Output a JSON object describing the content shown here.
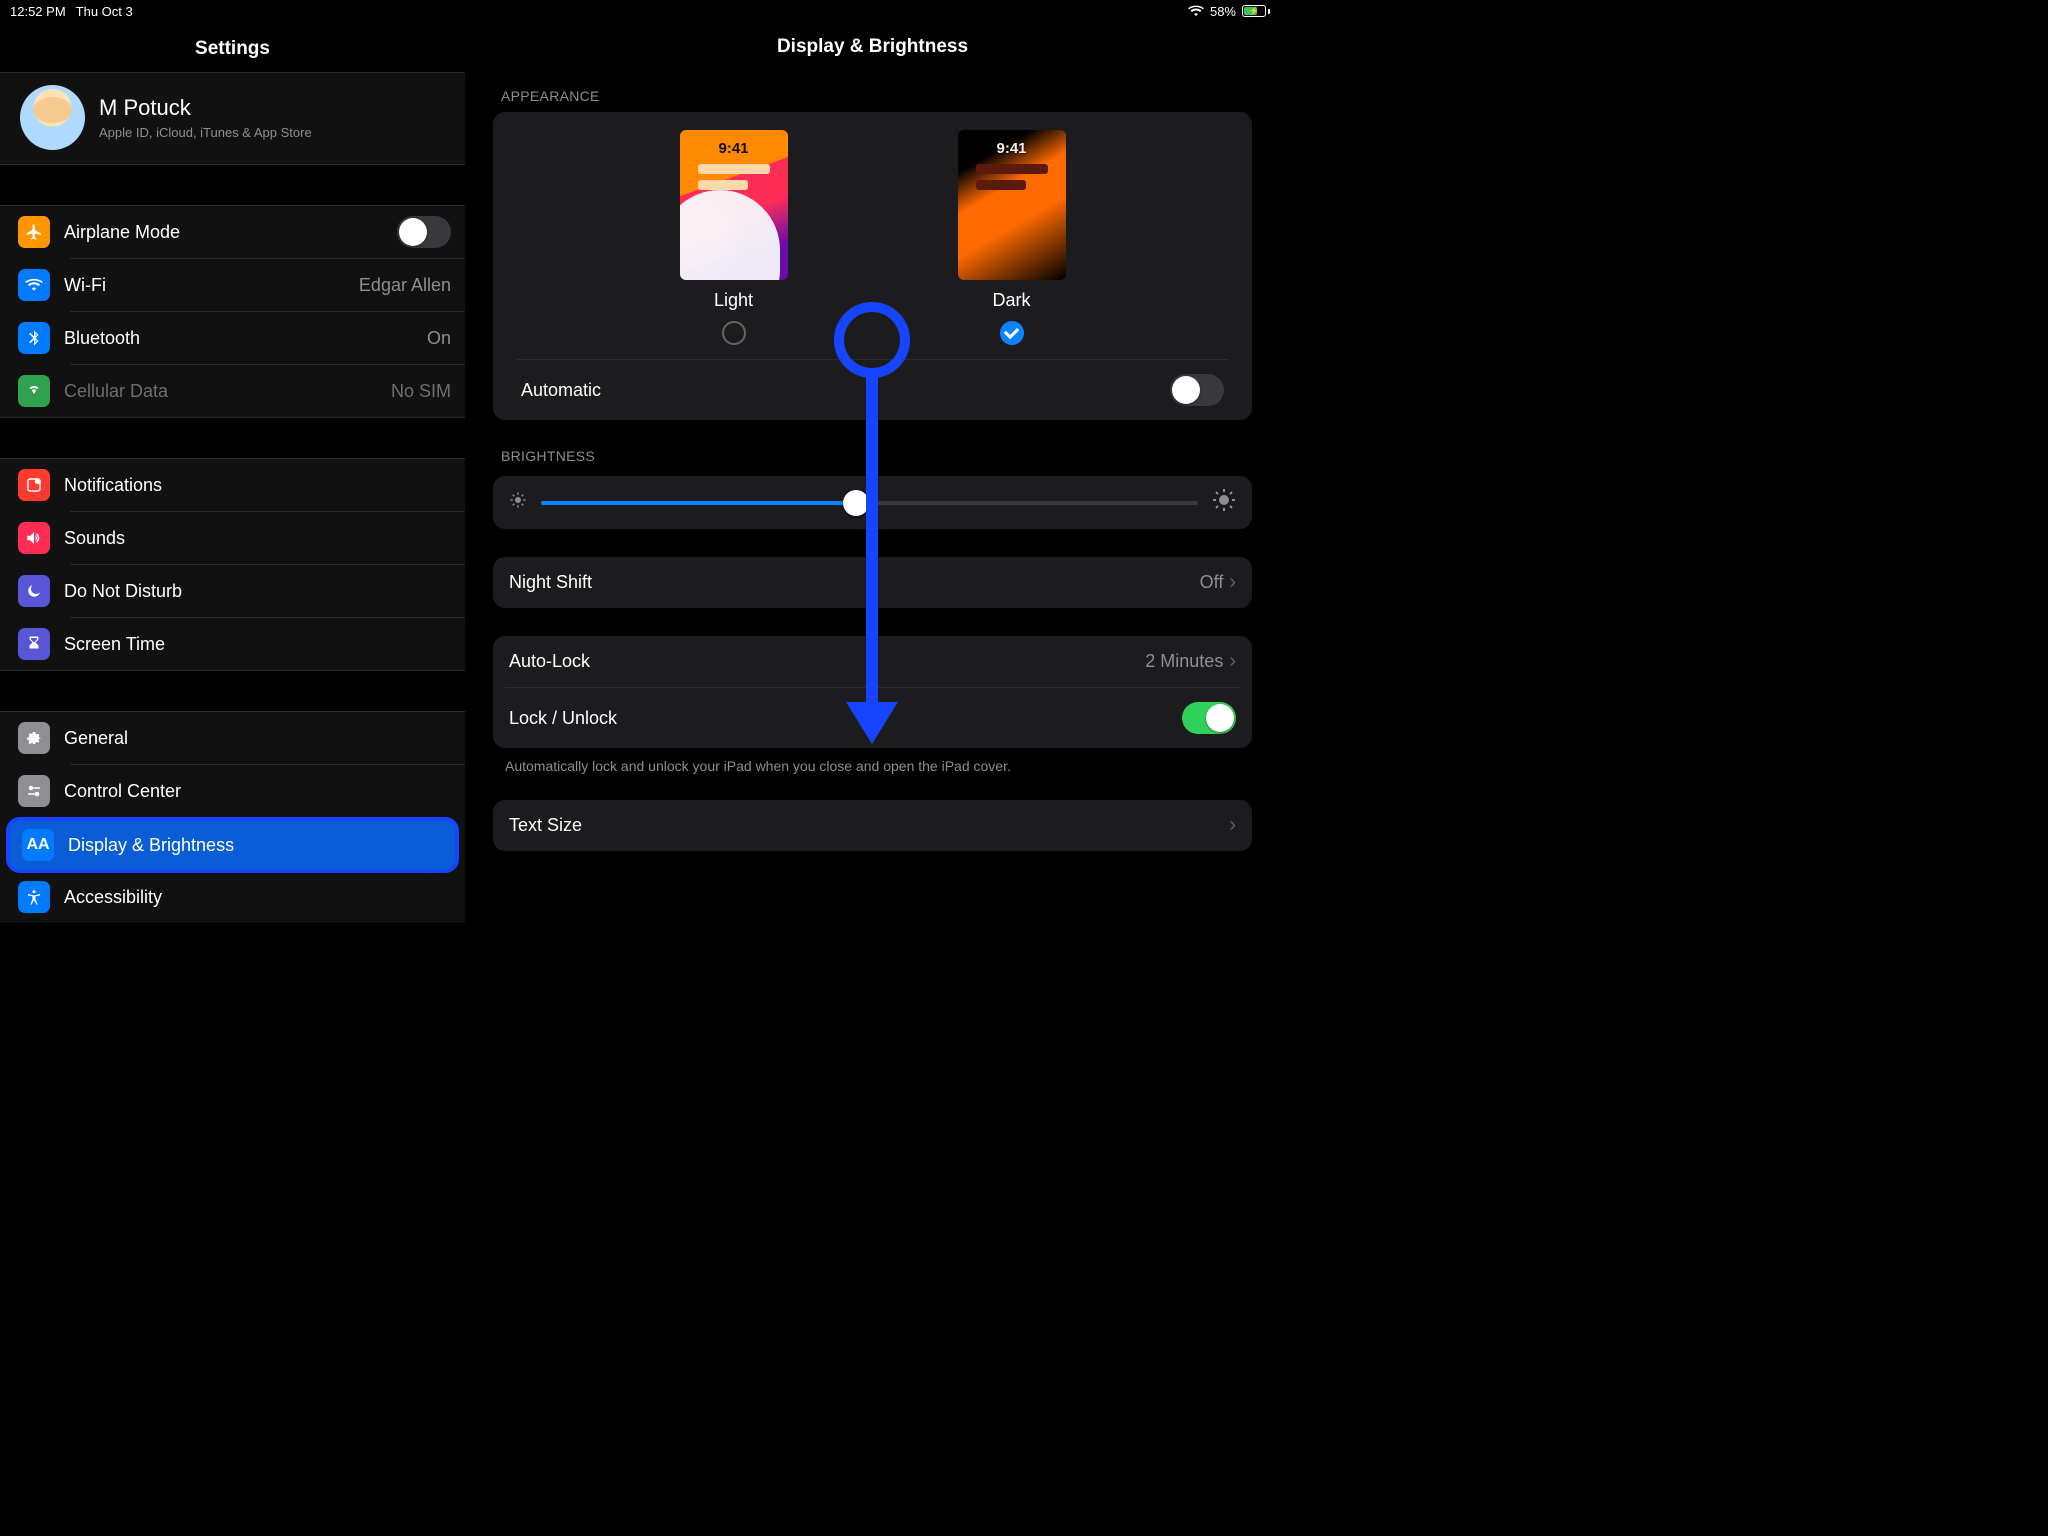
{
  "status": {
    "time": "12:52 PM",
    "date": "Thu Oct 3",
    "battery_percent": "58%"
  },
  "sidebar": {
    "title": "Settings",
    "profile": {
      "name": "M Potuck",
      "subtitle": "Apple ID, iCloud, iTunes & App Store"
    },
    "group_conn": {
      "airplane": "Airplane Mode",
      "wifi_label": "Wi-Fi",
      "wifi_value": "Edgar Allen",
      "bt_label": "Bluetooth",
      "bt_value": "On",
      "cell_label": "Cellular Data",
      "cell_value": "No SIM"
    },
    "group_notif": {
      "notifications": "Notifications",
      "sounds": "Sounds",
      "dnd": "Do Not Disturb",
      "screen_time": "Screen Time"
    },
    "group_general": {
      "general": "General",
      "control_center": "Control Center",
      "display": "Display & Brightness",
      "accessibility": "Accessibility"
    }
  },
  "main": {
    "title": "Display & Brightness",
    "appearance_header": "APPEARANCE",
    "theme_time": "9:41",
    "light_label": "Light",
    "dark_label": "Dark",
    "automatic": "Automatic",
    "brightness_header": "BRIGHTNESS",
    "brightness_value_pct": 48,
    "night_shift_label": "Night Shift",
    "night_shift_value": "Off",
    "auto_lock_label": "Auto-Lock",
    "auto_lock_value": "2 Minutes",
    "lock_unlock_label": "Lock / Unlock",
    "lock_unlock_note": "Automatically lock and unlock your iPad when you close and open the iPad cover.",
    "text_size_label": "Text Size"
  }
}
